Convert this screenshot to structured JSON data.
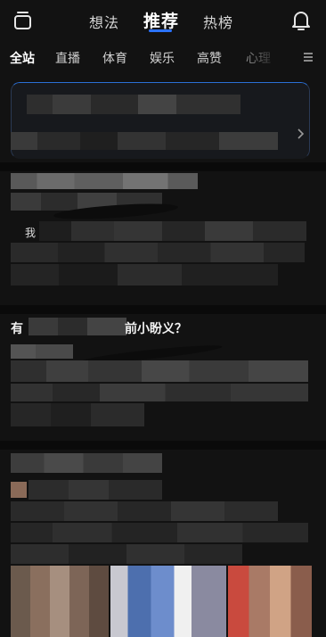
{
  "header": {
    "tabs": [
      {
        "label": "想法"
      },
      {
        "label": "推荐"
      },
      {
        "label": "热榜"
      }
    ],
    "active_tab": "推荐"
  },
  "channels": {
    "items": [
      {
        "label": "全站"
      },
      {
        "label": "直播"
      },
      {
        "label": "体育"
      },
      {
        "label": "娱乐"
      },
      {
        "label": "高赞"
      },
      {
        "label": "心理"
      }
    ],
    "active": "全站"
  },
  "feed": {
    "card2": {
      "snippet_fragment": "我"
    },
    "card3": {
      "title_fragment_start": "有",
      "title_fragment_end": "前小盼义？"
    }
  },
  "colors": {
    "background": "#121212",
    "accent": "#2b73ff",
    "banner_border": "#2a6fd6"
  }
}
